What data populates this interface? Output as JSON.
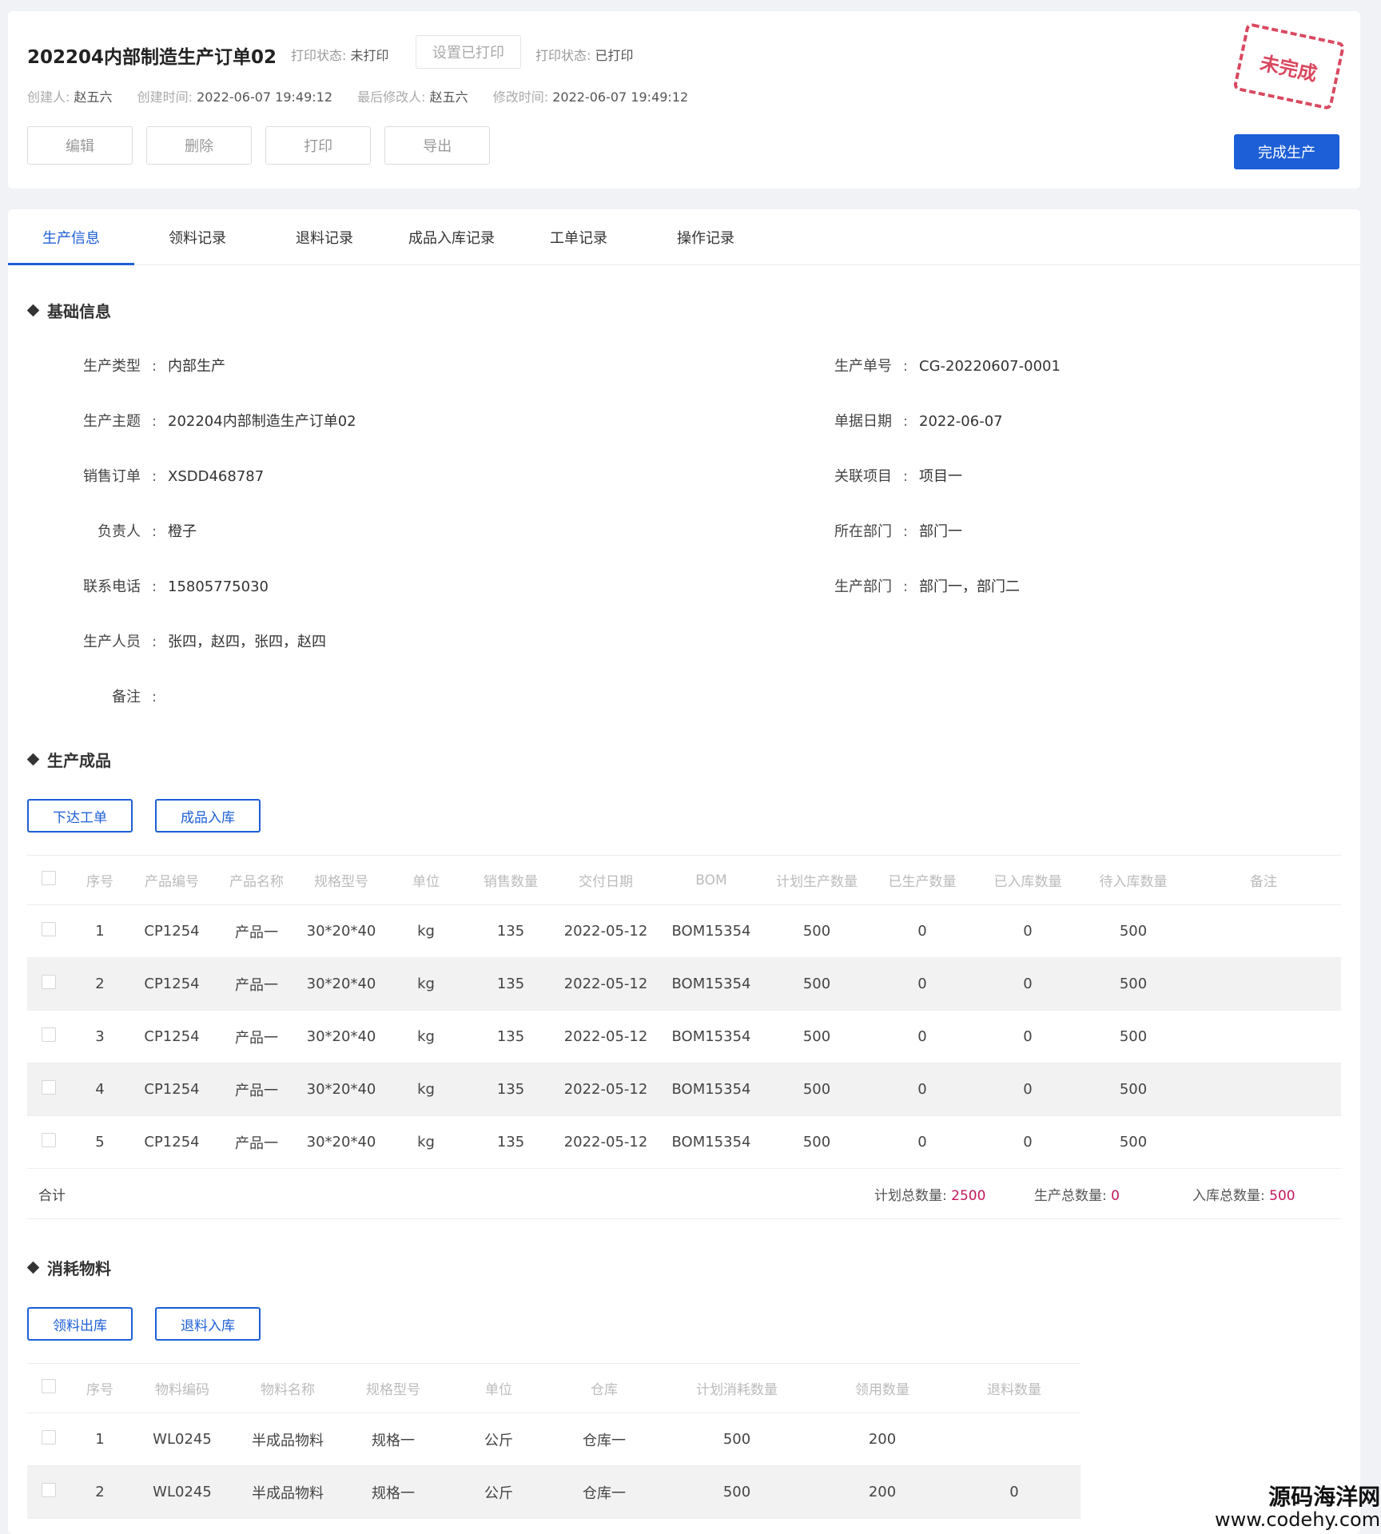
{
  "header": {
    "title": "202204内部制造生产订单02",
    "print_status_label": "打印状态:",
    "print_status_value": "未打印",
    "set_printed_button": "设置已打印",
    "print_status_label2": "打印状态:",
    "print_status_value2": "已打印",
    "creator_label": "创建人:",
    "creator": "赵五六",
    "created_label": "创建时间:",
    "created": "2022-06-07 19:49:12",
    "modifier_label": "最后修改人:",
    "modifier": "赵五六",
    "modified_label": "修改时间:",
    "modified": "2022-06-07 19:49:12",
    "buttons": [
      "编辑",
      "删除",
      "打印",
      "导出"
    ],
    "stamp": "未完成",
    "finish_button": "完成生产"
  },
  "tabs": [
    "生产信息",
    "领料记录",
    "退料记录",
    "成品入库记录",
    "工单记录",
    "操作记录"
  ],
  "basic": {
    "title": "基础信息",
    "left": [
      {
        "label": "生产类型",
        "value": "内部生产"
      },
      {
        "label": "生产主题",
        "value": "202204内部制造生产订单02"
      },
      {
        "label": "销售订单",
        "value": "XSDD468787"
      },
      {
        "label": "负责人",
        "value": "橙子"
      },
      {
        "label": "联系电话",
        "value": "15805775030"
      },
      {
        "label": "生产人员",
        "value": "张四，赵四，张四，赵四"
      },
      {
        "label": "备注",
        "value": ""
      }
    ],
    "right": [
      {
        "label": "生产单号",
        "value": "CG-20220607-0001"
      },
      {
        "label": "单据日期",
        "value": "2022-06-07"
      },
      {
        "label": "关联项目",
        "value": "项目一"
      },
      {
        "label": "所在部门",
        "value": "部门一"
      },
      {
        "label": "生产部门",
        "value": "部门一，部门二"
      }
    ],
    "separator": ":"
  },
  "products": {
    "title": "生产成品",
    "buttons": [
      "下达工单",
      "成品入库"
    ],
    "columns": [
      "序号",
      "产品编号",
      "产品名称",
      "规格型号",
      "单位",
      "销售数量",
      "交付日期",
      "BOM",
      "计划生产数量",
      "已生产数量",
      "已入库数量",
      "待入库数量",
      "备注"
    ],
    "rows": [
      [
        "1",
        "CP1254",
        "产品一",
        "30*20*40",
        "kg",
        "135",
        "2022-05-12",
        "BOM15354",
        "500",
        "0",
        "0",
        "500",
        ""
      ],
      [
        "2",
        "CP1254",
        "产品一",
        "30*20*40",
        "kg",
        "135",
        "2022-05-12",
        "BOM15354",
        "500",
        "0",
        "0",
        "500",
        ""
      ],
      [
        "3",
        "CP1254",
        "产品一",
        "30*20*40",
        "kg",
        "135",
        "2022-05-12",
        "BOM15354",
        "500",
        "0",
        "0",
        "500",
        ""
      ],
      [
        "4",
        "CP1254",
        "产品一",
        "30*20*40",
        "kg",
        "135",
        "2022-05-12",
        "BOM15354",
        "500",
        "0",
        "0",
        "500",
        ""
      ],
      [
        "5",
        "CP1254",
        "产品一",
        "30*20*40",
        "kg",
        "135",
        "2022-05-12",
        "BOM15354",
        "500",
        "0",
        "0",
        "500",
        ""
      ]
    ],
    "total_label": "合计",
    "plan_total_label": "计划总数量:",
    "plan_total": "2500",
    "produced_total_label": "生产总数量:",
    "produced_total": "0",
    "stored_total_label": "入库总数量:",
    "stored_total": "500"
  },
  "materials": {
    "title": "消耗物料",
    "buttons": [
      "领料出库",
      "退料入库"
    ],
    "columns": [
      "序号",
      "物料编码",
      "物料名称",
      "规格型号",
      "单位",
      "仓库",
      "计划消耗数量",
      "领用数量",
      "退料数量"
    ],
    "rows": [
      [
        "1",
        "WL0245",
        "半成品物料",
        "规格一",
        "公斤",
        "仓库一",
        "500",
        "200",
        ""
      ],
      [
        "2",
        "WL0245",
        "半成品物料",
        "规格一",
        "公斤",
        "仓库一",
        "500",
        "200",
        "0"
      ]
    ]
  },
  "watermark": {
    "line1": "源码海洋网",
    "line2": "www.codehy.com"
  }
}
